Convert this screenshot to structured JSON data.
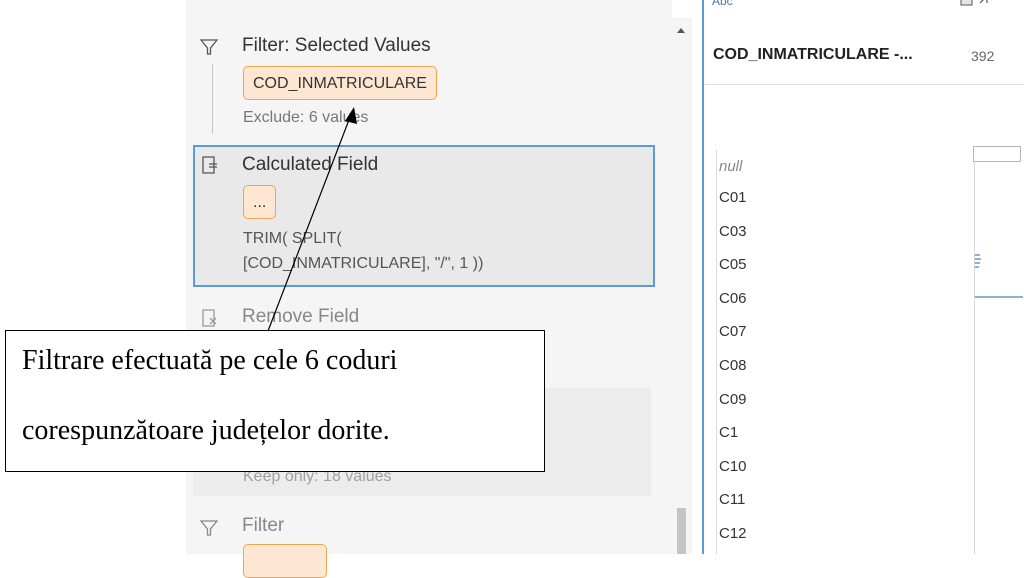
{
  "steps": [
    {
      "icon": "filter-icon",
      "title": "Filter: Selected Values",
      "pill": "COD_INMATRICULARE",
      "subtitle": "Exclude: 6 values"
    },
    {
      "icon": "calculated-field-icon",
      "title": "Calculated Field",
      "pill": "...",
      "code_line1": "TRIM( SPLIT(",
      "code_line2": "[COD_INMATRICULARE], \"/\", 1 ))"
    },
    {
      "icon": "remove-field-icon",
      "title": "Remove Field"
    },
    {
      "subtitle": "Keep only: 18 values"
    },
    {
      "icon": "filter-icon",
      "title": "Filter"
    }
  ],
  "right_panel": {
    "type_label": "Abc",
    "field_name": "COD_INMATRICULARE -...",
    "count": "392",
    "values": [
      "null",
      "C01",
      "C03",
      "C05",
      "C06",
      "C07",
      "C08",
      "C09",
      "C1",
      "C10",
      "C11",
      "C12"
    ]
  },
  "annotation": {
    "line1": "Filtrare efectuată pe cele 6 coduri",
    "line2": "corespunzătoare județelor dorite."
  },
  "colors": {
    "accent_blue": "#5a9bd5",
    "pill_fill": "#fde7d2",
    "pill_border": "#f0a552"
  }
}
